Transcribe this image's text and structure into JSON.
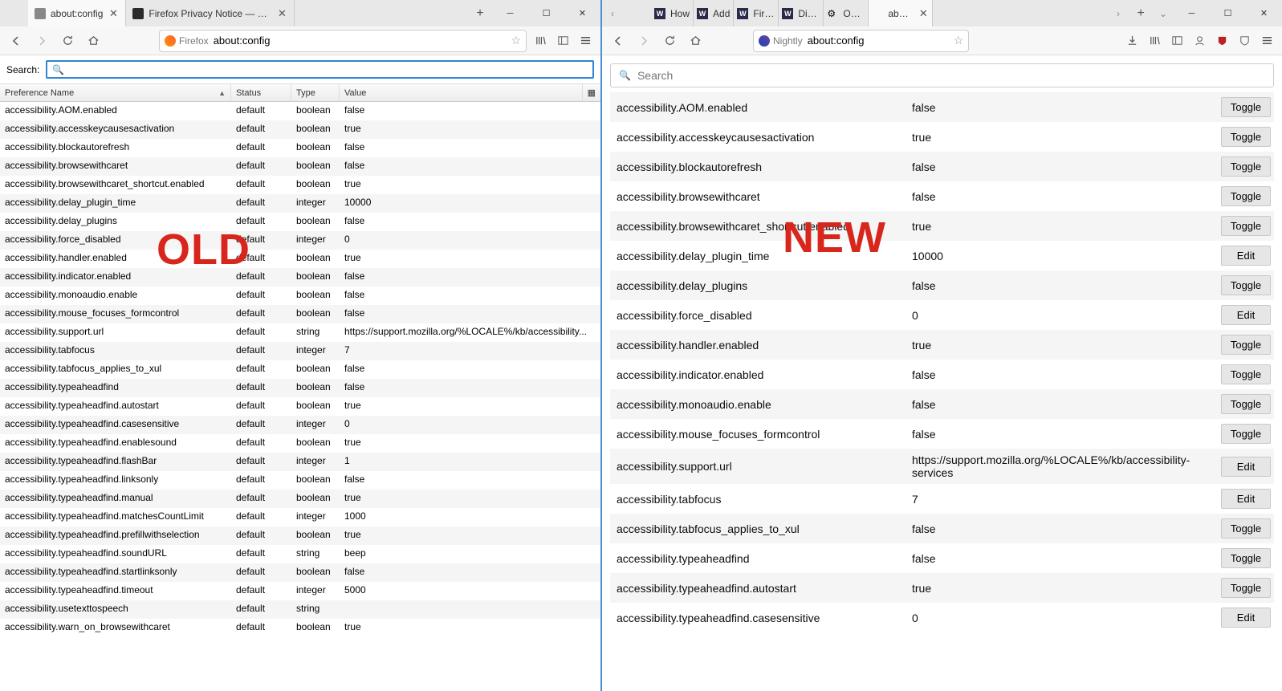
{
  "left": {
    "tabs": [
      {
        "label": "about:config",
        "active": true
      },
      {
        "label": "Firefox Privacy Notice — Mozi",
        "active": false
      }
    ],
    "identity_label": "Firefox",
    "url": "about:config",
    "search_label": "Search:",
    "columns": {
      "name": "Preference Name",
      "status": "Status",
      "type": "Type",
      "value": "Value"
    },
    "rows": [
      {
        "name": "accessibility.AOM.enabled",
        "status": "default",
        "type": "boolean",
        "value": "false"
      },
      {
        "name": "accessibility.accesskeycausesactivation",
        "status": "default",
        "type": "boolean",
        "value": "true"
      },
      {
        "name": "accessibility.blockautorefresh",
        "status": "default",
        "type": "boolean",
        "value": "false"
      },
      {
        "name": "accessibility.browsewithcaret",
        "status": "default",
        "type": "boolean",
        "value": "false"
      },
      {
        "name": "accessibility.browsewithcaret_shortcut.enabled",
        "status": "default",
        "type": "boolean",
        "value": "true"
      },
      {
        "name": "accessibility.delay_plugin_time",
        "status": "default",
        "type": "integer",
        "value": "10000"
      },
      {
        "name": "accessibility.delay_plugins",
        "status": "default",
        "type": "boolean",
        "value": "false"
      },
      {
        "name": "accessibility.force_disabled",
        "status": "default",
        "type": "integer",
        "value": "0"
      },
      {
        "name": "accessibility.handler.enabled",
        "status": "default",
        "type": "boolean",
        "value": "true"
      },
      {
        "name": "accessibility.indicator.enabled",
        "status": "default",
        "type": "boolean",
        "value": "false"
      },
      {
        "name": "accessibility.monoaudio.enable",
        "status": "default",
        "type": "boolean",
        "value": "false"
      },
      {
        "name": "accessibility.mouse_focuses_formcontrol",
        "status": "default",
        "type": "boolean",
        "value": "false"
      },
      {
        "name": "accessibility.support.url",
        "status": "default",
        "type": "string",
        "value": "https://support.mozilla.org/%LOCALE%/kb/accessibility..."
      },
      {
        "name": "accessibility.tabfocus",
        "status": "default",
        "type": "integer",
        "value": "7"
      },
      {
        "name": "accessibility.tabfocus_applies_to_xul",
        "status": "default",
        "type": "boolean",
        "value": "false"
      },
      {
        "name": "accessibility.typeaheadfind",
        "status": "default",
        "type": "boolean",
        "value": "false"
      },
      {
        "name": "accessibility.typeaheadfind.autostart",
        "status": "default",
        "type": "boolean",
        "value": "true"
      },
      {
        "name": "accessibility.typeaheadfind.casesensitive",
        "status": "default",
        "type": "integer",
        "value": "0"
      },
      {
        "name": "accessibility.typeaheadfind.enablesound",
        "status": "default",
        "type": "boolean",
        "value": "true"
      },
      {
        "name": "accessibility.typeaheadfind.flashBar",
        "status": "default",
        "type": "integer",
        "value": "1"
      },
      {
        "name": "accessibility.typeaheadfind.linksonly",
        "status": "default",
        "type": "boolean",
        "value": "false"
      },
      {
        "name": "accessibility.typeaheadfind.manual",
        "status": "default",
        "type": "boolean",
        "value": "true"
      },
      {
        "name": "accessibility.typeaheadfind.matchesCountLimit",
        "status": "default",
        "type": "integer",
        "value": "1000"
      },
      {
        "name": "accessibility.typeaheadfind.prefillwithselection",
        "status": "default",
        "type": "boolean",
        "value": "true"
      },
      {
        "name": "accessibility.typeaheadfind.soundURL",
        "status": "default",
        "type": "string",
        "value": "beep"
      },
      {
        "name": "accessibility.typeaheadfind.startlinksonly",
        "status": "default",
        "type": "boolean",
        "value": "false"
      },
      {
        "name": "accessibility.typeaheadfind.timeout",
        "status": "default",
        "type": "integer",
        "value": "5000"
      },
      {
        "name": "accessibility.usetexttospeech",
        "status": "default",
        "type": "string",
        "value": ""
      },
      {
        "name": "accessibility.warn_on_browsewithcaret",
        "status": "default",
        "type": "boolean",
        "value": "true"
      }
    ],
    "overlay": "OLD"
  },
  "right": {
    "tabs": [
      {
        "label": "How",
        "icon": "w"
      },
      {
        "label": "Add",
        "icon": "w"
      },
      {
        "label": "Firefo",
        "icon": "w"
      },
      {
        "label": "Disab",
        "icon": "w"
      },
      {
        "label": "Optio",
        "icon": "gear"
      },
      {
        "label": "about:",
        "icon": "",
        "active": true
      }
    ],
    "identity_label": "Nightly",
    "url": "about:config",
    "search_placeholder": "Search",
    "rows": [
      {
        "name": "accessibility.AOM.enabled",
        "value": "false",
        "action": "Toggle"
      },
      {
        "name": "accessibility.accesskeycausesactivation",
        "value": "true",
        "action": "Toggle"
      },
      {
        "name": "accessibility.blockautorefresh",
        "value": "false",
        "action": "Toggle"
      },
      {
        "name": "accessibility.browsewithcaret",
        "value": "false",
        "action": "Toggle"
      },
      {
        "name": "accessibility.browsewithcaret_shortcut.enabled",
        "value": "true",
        "action": "Toggle"
      },
      {
        "name": "accessibility.delay_plugin_time",
        "value": "10000",
        "action": "Edit"
      },
      {
        "name": "accessibility.delay_plugins",
        "value": "false",
        "action": "Toggle"
      },
      {
        "name": "accessibility.force_disabled",
        "value": "0",
        "action": "Edit"
      },
      {
        "name": "accessibility.handler.enabled",
        "value": "true",
        "action": "Toggle"
      },
      {
        "name": "accessibility.indicator.enabled",
        "value": "false",
        "action": "Toggle"
      },
      {
        "name": "accessibility.monoaudio.enable",
        "value": "false",
        "action": "Toggle"
      },
      {
        "name": "accessibility.mouse_focuses_formcontrol",
        "value": "false",
        "action": "Toggle"
      },
      {
        "name": "accessibility.support.url",
        "value": "https://support.mozilla.org/%LOCALE%/kb/accessibility-services",
        "action": "Edit"
      },
      {
        "name": "accessibility.tabfocus",
        "value": "7",
        "action": "Edit"
      },
      {
        "name": "accessibility.tabfocus_applies_to_xul",
        "value": "false",
        "action": "Toggle"
      },
      {
        "name": "accessibility.typeaheadfind",
        "value": "false",
        "action": "Toggle"
      },
      {
        "name": "accessibility.typeaheadfind.autostart",
        "value": "true",
        "action": "Toggle"
      },
      {
        "name": "accessibility.typeaheadfind.casesensitive",
        "value": "0",
        "action": "Edit"
      }
    ],
    "overlay": "NEW"
  }
}
